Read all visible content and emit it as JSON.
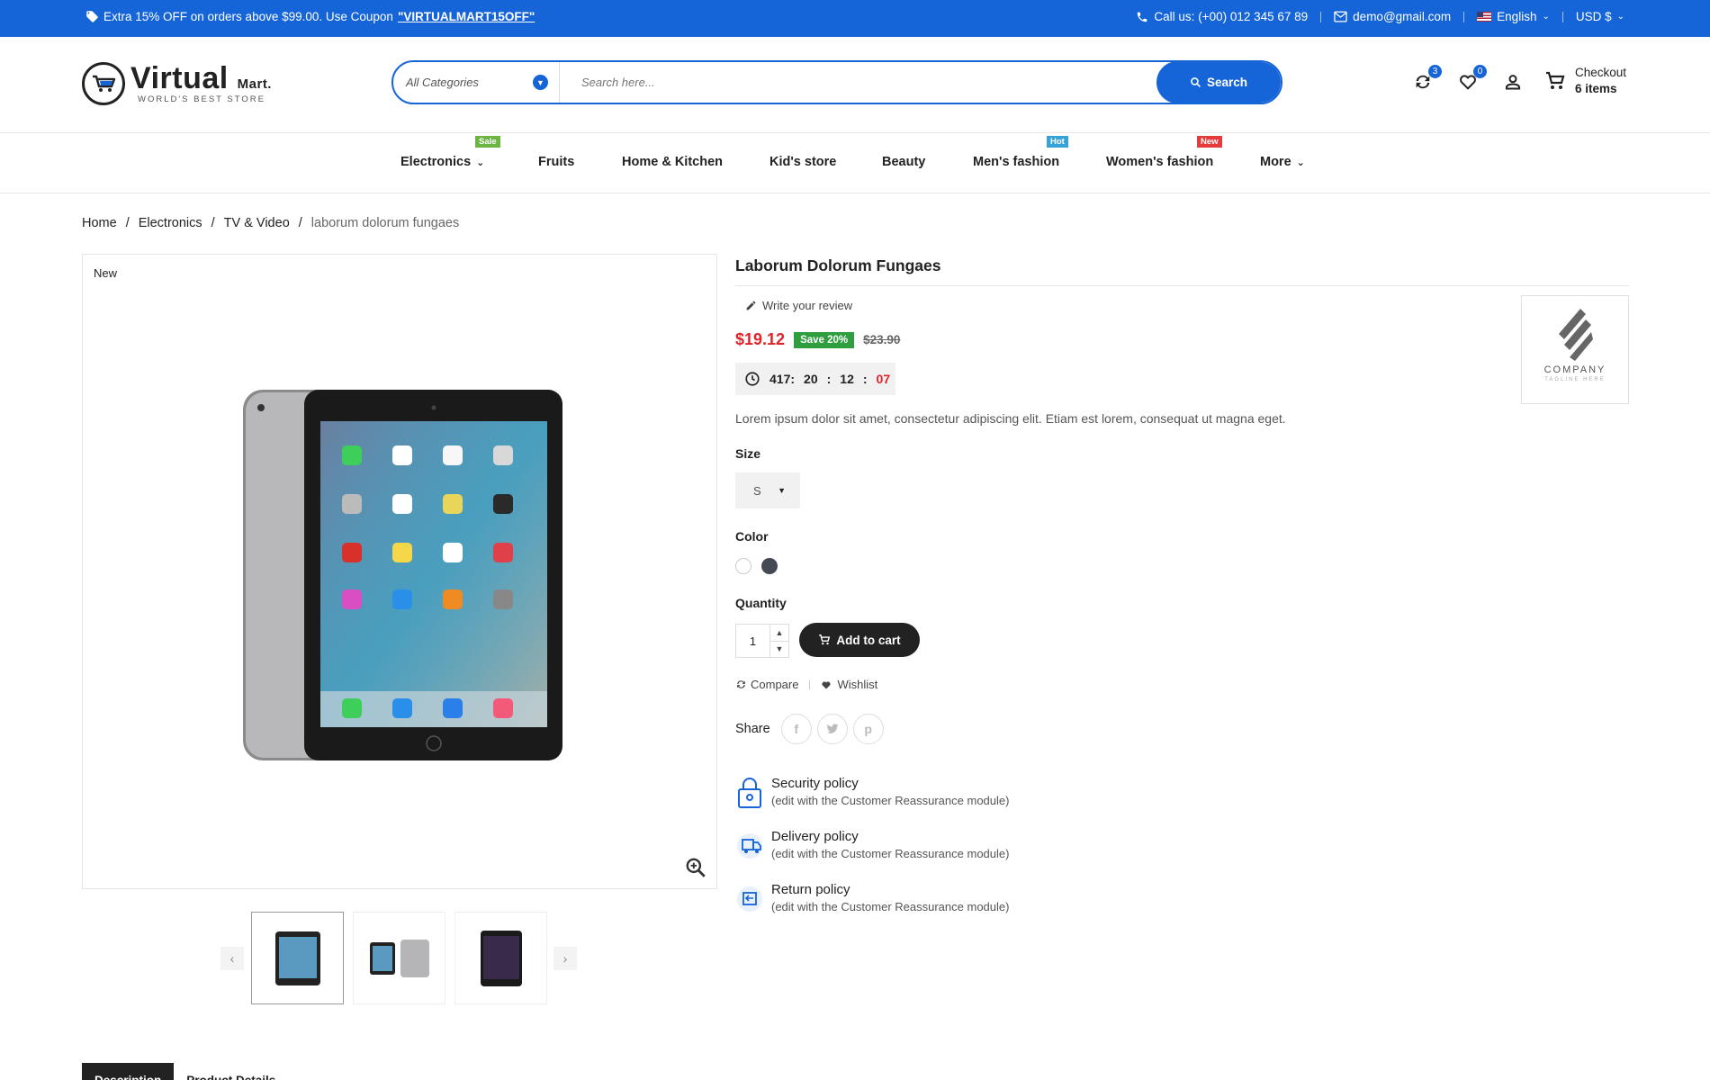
{
  "topbar": {
    "promo_text": "Extra 15% OFF on orders above $99.00. Use Coupon",
    "coupon_code": "\"VIRTUALMART15OFF\"",
    "phone": "Call us: (+00) 012 345 67 89",
    "email": "demo@gmail.com",
    "language": "English",
    "currency": "USD $"
  },
  "header": {
    "logo_main": "Virtual",
    "logo_suffix": "Mart.",
    "logo_tagline": "WORLD'S BEST STORE",
    "search_category": "All Categories",
    "search_placeholder": "Search here...",
    "search_button": "Search",
    "compare_count": "3",
    "wishlist_count": "0",
    "checkout_label": "Checkout",
    "cart_items": "6 items"
  },
  "nav": [
    {
      "label": "Electronics",
      "tag": "Sale",
      "tag_color": "#6bb543",
      "dropdown": true
    },
    {
      "label": "Fruits"
    },
    {
      "label": "Home & Kitchen"
    },
    {
      "label": "Kid's store"
    },
    {
      "label": "Beauty"
    },
    {
      "label": "Men's fashion",
      "tag": "Hot",
      "tag_color": "#36a3d6"
    },
    {
      "label": "Women's fashion",
      "tag": "New",
      "tag_color": "#e53b3b"
    },
    {
      "label": "More",
      "dropdown": true
    }
  ],
  "breadcrumb": [
    "Home",
    "Electronics",
    "TV & Video",
    "laborum dolorum fungaes"
  ],
  "product": {
    "flag": "New",
    "title": "Laborum Dolorum Fungaes",
    "review_link": "Write your review",
    "price": "$19.12",
    "save_badge": "Save 20%",
    "old_price": "$23.90",
    "timer": {
      "days": "417:",
      "hours": "20",
      "minutes": "12",
      "seconds": "07"
    },
    "description": "Lorem ipsum dolor sit amet, consectetur adipiscing elit. Etiam est lorem, consequat ut magna eget.",
    "size_label": "Size",
    "size_value": "S",
    "color_label": "Color",
    "colors": [
      "#ffffff",
      "#434a54"
    ],
    "quantity_label": "Quantity",
    "quantity": "1",
    "add_to_cart": "Add to cart",
    "compare": "Compare",
    "wishlist": "Wishlist",
    "share_label": "Share",
    "brand_name": "COMPANY",
    "brand_tagline": "TAGLINE HERE"
  },
  "policies": [
    {
      "title": "Security policy",
      "subtitle": "(edit with the Customer Reassurance module)"
    },
    {
      "title": "Delivery policy",
      "subtitle": "(edit with the Customer Reassurance module)"
    },
    {
      "title": "Return policy",
      "subtitle": "(edit with the Customer Reassurance module)"
    }
  ],
  "tabs": [
    "Description",
    "Product Details"
  ],
  "colors": {
    "primary": "#1565d8",
    "price": "#e0232a",
    "save": "#2e9e3f",
    "dark": "#222222"
  }
}
